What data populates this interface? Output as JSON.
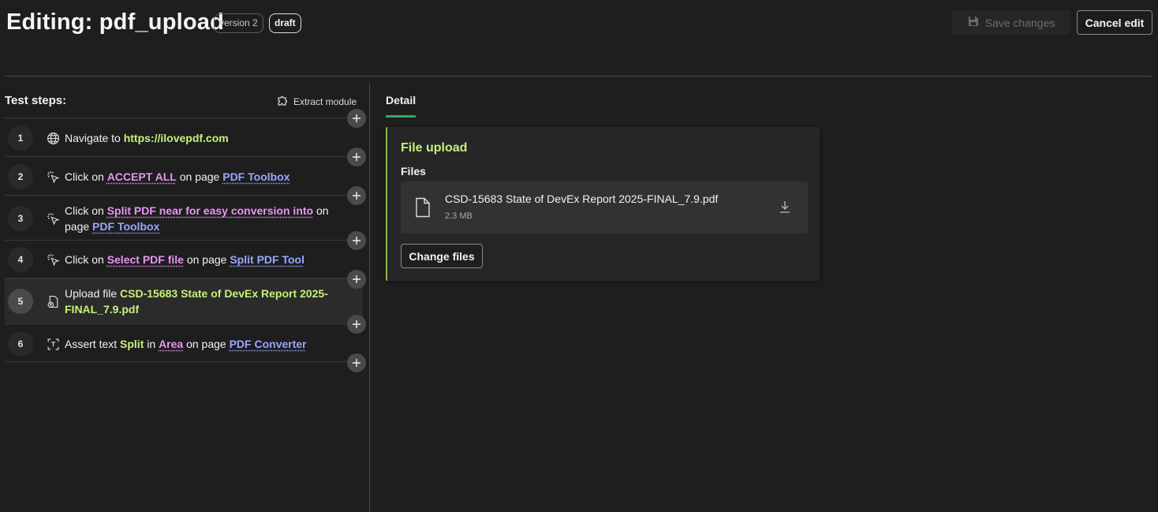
{
  "header": {
    "title": "Editing: pdf_upload",
    "version_badge": "version 2",
    "status_badge": "draft",
    "save_label": "Save changes",
    "cancel_label": "Cancel edit"
  },
  "steps_panel": {
    "title": "Test steps:",
    "extract_label": "Extract module"
  },
  "steps": [
    {
      "num": "1",
      "icon": "globe-icon",
      "parts": [
        "Navigate to ",
        "https://ilovepdf.com"
      ]
    },
    {
      "num": "2",
      "icon": "click-icon",
      "parts": [
        "Click on ",
        "ACCEPT ALL",
        " on page ",
        "PDF Toolbox"
      ]
    },
    {
      "num": "3",
      "icon": "click-icon",
      "parts": [
        "Click on ",
        "Split PDF near for easy conversion into",
        " on page ",
        "PDF Toolbox"
      ]
    },
    {
      "num": "4",
      "icon": "click-icon",
      "parts": [
        "Click on ",
        "Select PDF file",
        " on page ",
        "Split PDF Tool"
      ]
    },
    {
      "num": "5",
      "icon": "upload-file-icon",
      "parts": [
        "Upload file ",
        "CSD-15683 State of DevEx Report 2025-FINAL_7.9.pdf"
      ]
    },
    {
      "num": "6",
      "icon": "assert-text-icon",
      "parts": [
        "Assert text ",
        "Split",
        " in ",
        "Area",
        " on page ",
        "PDF Converter"
      ]
    }
  ],
  "detail": {
    "tab_label": "Detail",
    "card_title": "File upload",
    "files_label": "Files",
    "file": {
      "name": "CSD-15683 State of DevEx Report 2025-FINAL_7.9.pdf",
      "size": "2.3 MB"
    },
    "change_label": "Change files"
  },
  "colors": {
    "accent_green": "#35a566",
    "value_lime": "#c6f17a",
    "element_pink": "#e895f2",
    "page_blue": "#98a6ff"
  }
}
